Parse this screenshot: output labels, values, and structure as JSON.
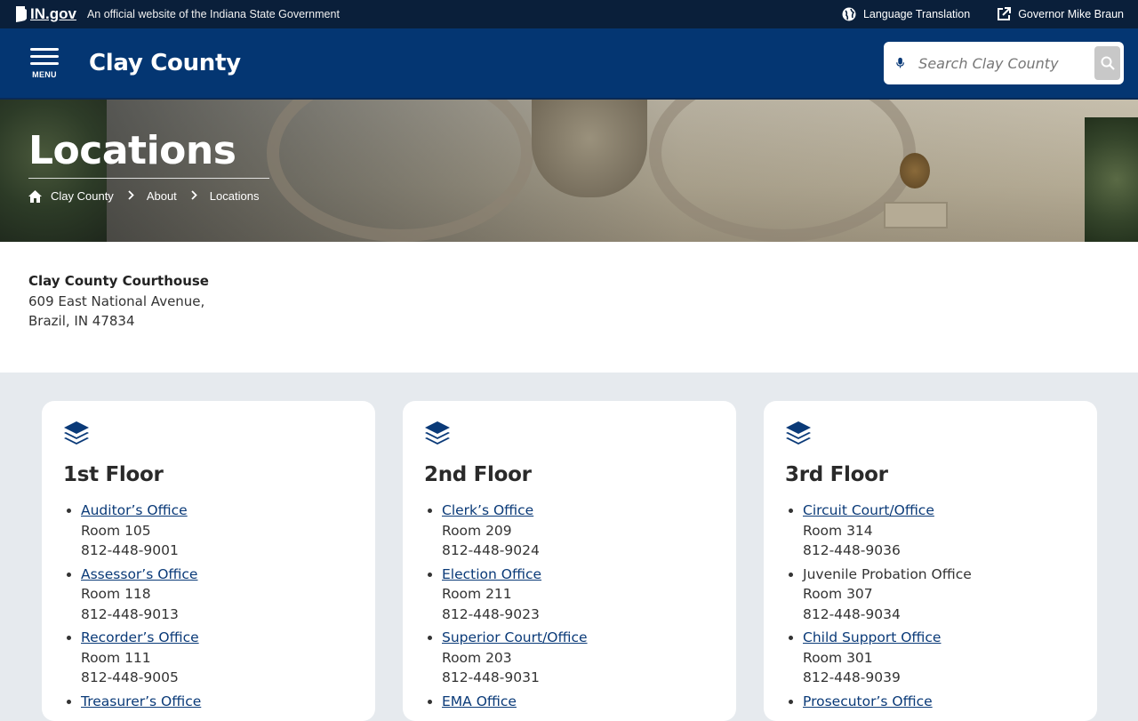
{
  "gov_bar": {
    "logo_text": "IN.gov",
    "official_text": "An official website of the Indiana State Government",
    "language_link": "Language Translation",
    "governor_link": "Governor Mike Braun"
  },
  "header": {
    "menu_label": "MENU",
    "site_title": "Clay County",
    "search_placeholder": "Search Clay County"
  },
  "hero": {
    "title": "Locations",
    "breadcrumb": [
      "Clay County",
      "About",
      "Locations"
    ]
  },
  "address": {
    "name": "Clay County Courthouse",
    "line1": "609 East National Avenue,",
    "line2": "Brazil, IN 47834"
  },
  "floors": [
    {
      "title": "1st Floor",
      "offices": [
        {
          "name": "Auditor’s Office",
          "room": "Room 105",
          "phone": "812-448-9001"
        },
        {
          "name": "Assessor’s Office",
          "room": "Room 118",
          "phone": "812-448-9013"
        },
        {
          "name": "Recorder’s Office",
          "room": "Room 111",
          "phone": "812-448-9005"
        },
        {
          "name": "Treasurer’s Office"
        }
      ]
    },
    {
      "title": "2nd Floor",
      "offices": [
        {
          "name": "Clerk’s Office",
          "room": "Room 209",
          "phone": "812-448-9024"
        },
        {
          "name": "Election Office",
          "room": "Room 211",
          "phone": "812-448-9023"
        },
        {
          "name": "Superior Court/Office",
          "room": "Room 203",
          "phone": "812-448-9031"
        },
        {
          "name": "EMA Office"
        }
      ]
    },
    {
      "title": "3rd Floor",
      "offices": [
        {
          "name": "Circuit Court/Office",
          "room": "Room 314",
          "phone": "812-448-9036"
        },
        {
          "name": "Juvenile Probation Office",
          "room": "Room 307",
          "phone": "812-448-9034",
          "plain": true
        },
        {
          "name": "Child Support Office",
          "room": "Room 301",
          "phone": "812-448-9039"
        },
        {
          "name": "Prosecutor’s Office"
        }
      ]
    }
  ],
  "colors": {
    "gov_bar": "#0a1f3a",
    "header": "#043672",
    "link": "#0a3a78",
    "section_bg": "#e6eaee"
  }
}
